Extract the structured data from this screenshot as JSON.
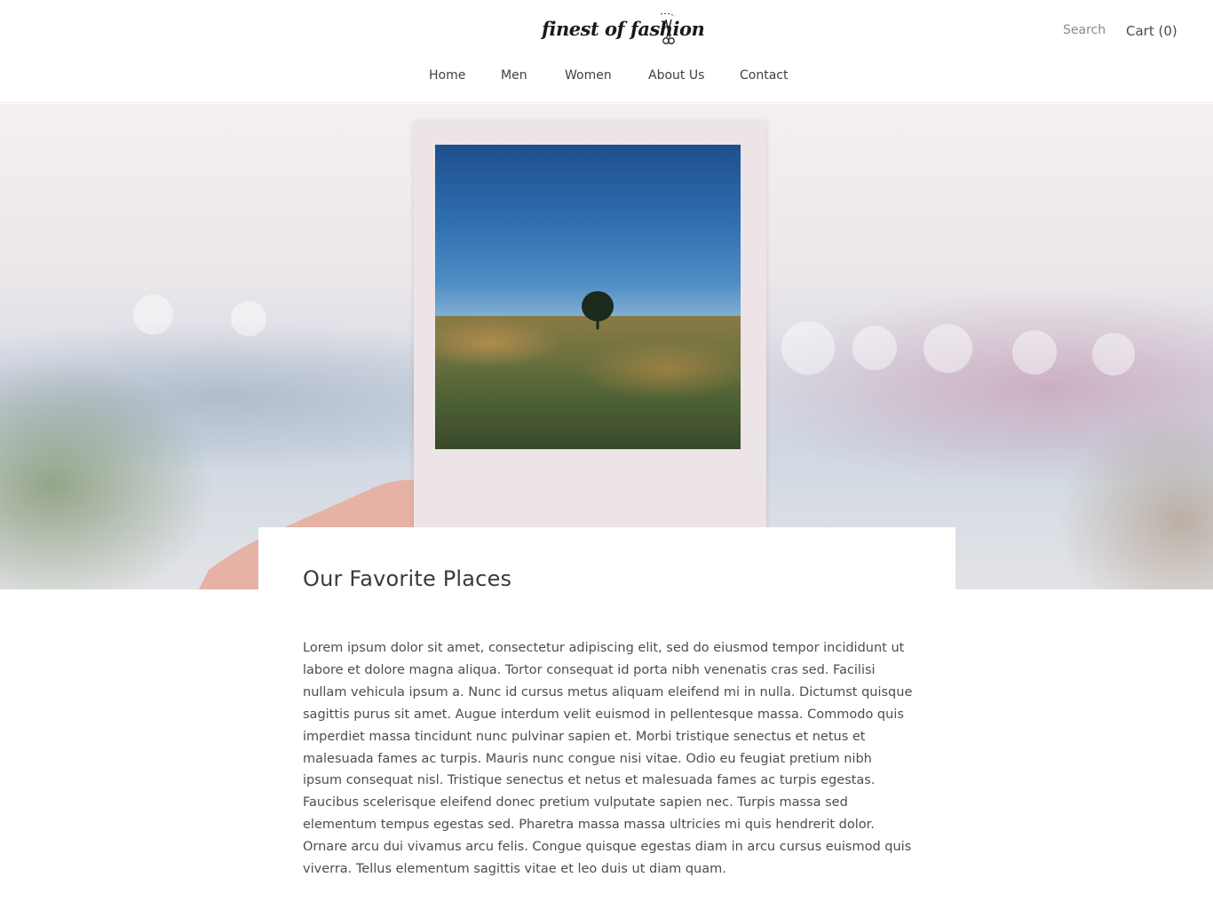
{
  "header": {
    "logo_text": "finest of fashion",
    "search_label": "Search",
    "cart_label": "Cart (0)"
  },
  "nav": {
    "items": [
      {
        "label": "Home"
      },
      {
        "label": "Men"
      },
      {
        "label": "Women"
      },
      {
        "label": "About Us"
      },
      {
        "label": "Contact"
      }
    ]
  },
  "hero": {
    "image_icon": "polaroid-photo-held-in-hand"
  },
  "article": {
    "title": "Our Favorite Places",
    "body_lines": [
      "Lorem ipsum dolor sit amet, consectetur adipiscing elit, sed do eiusmod tempor incididunt ut",
      "labore et dolore magna aliqua. Tortor consequat id porta nibh venenatis cras sed. Facilisi",
      "nullam vehicula ipsum a. Nunc id cursus metus aliquam eleifend mi in nulla. Dictumst quisque",
      "sagittis purus sit amet. Augue interdum velit euismod in pellentesque massa. Commodo quis",
      "imperdiet massa tincidunt nunc pulvinar sapien et. Morbi tristique senectus et netus et",
      "malesuada fames ac turpis. Mauris nunc congue nisi vitae. Odio eu feugiat pretium nibh",
      "ipsum consequat nisl. Tristique senectus et netus et malesuada fames ac turpis egestas.",
      "Faucibus scelerisque eleifend donec pretium vulputate sapien nec. Turpis massa sed",
      "elementum tempus egestas sed. Pharetra massa massa ultricies mi quis hendrerit dolor.",
      "Ornare arcu dui vivamus arcu felis. Congue quisque egestas diam in arcu cursus euismod quis",
      "viverra. Tellus elementum sagittis vitae et leo duis ut diam quam."
    ]
  },
  "colors": {
    "text": "#3d3d3d",
    "muted": "#8a8a8a",
    "background": "#ffffff"
  }
}
